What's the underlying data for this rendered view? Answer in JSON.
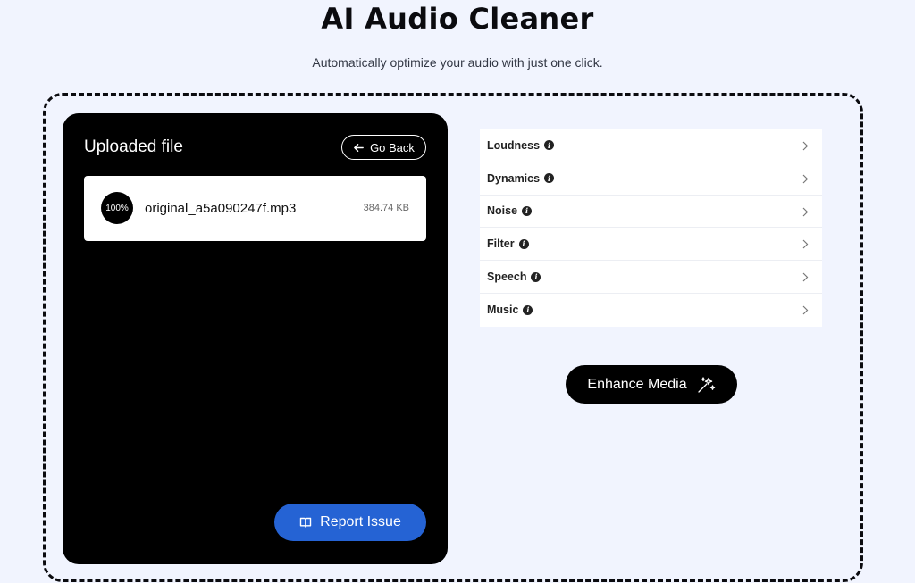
{
  "header": {
    "title": "AI Audio Cleaner",
    "subtitle": "Automatically optimize your audio with just one click."
  },
  "file_panel": {
    "title": "Uploaded file",
    "go_back_label": "Go Back",
    "file": {
      "progress": "100%",
      "name": "original_a5a090247f.mp3",
      "size": "384.74 KB"
    },
    "report_label": "Report Issue"
  },
  "settings": {
    "items": [
      {
        "label": "Loudness"
      },
      {
        "label": "Dynamics"
      },
      {
        "label": "Noise"
      },
      {
        "label": "Filter"
      },
      {
        "label": "Speech"
      },
      {
        "label": "Music"
      }
    ]
  },
  "enhance_label": "Enhance Media",
  "colors": {
    "background": "#f1f4fe",
    "panel": "#000000",
    "accent_blue": "#2563d4"
  }
}
